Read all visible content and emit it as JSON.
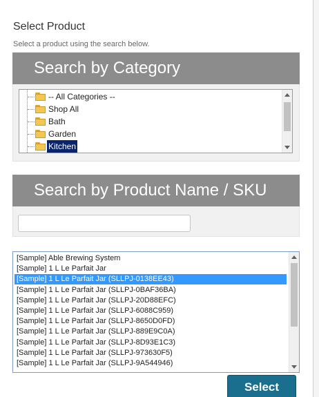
{
  "dialog": {
    "title": "Select Product",
    "subtitle": "Select a product using the search below."
  },
  "category_search": {
    "header": "Search by Category",
    "items": [
      {
        "label": "-- All Categories --",
        "icon": "folder-icon"
      },
      {
        "label": "Shop All",
        "icon": "folder-icon"
      },
      {
        "label": "Bath",
        "icon": "folder-icon"
      },
      {
        "label": "Garden",
        "icon": "folder-icon"
      },
      {
        "label": "Kitchen",
        "icon": "folder-icon",
        "selected": true
      }
    ]
  },
  "name_search": {
    "header": "Search by Product Name / SKU",
    "value": "",
    "placeholder": ""
  },
  "products": {
    "items": [
      "[Sample] Able Brewing System",
      "[Sample] 1 L Le Parfait Jar",
      "[Sample] 1 L Le Parfait Jar (SLLPJ-0138EE43)",
      "[Sample] 1 L Le Parfait Jar (SLLPJ-0BAF36BA)",
      "[Sample] 1 L Le Parfait Jar (SLLPJ-20D88EFC)",
      "[Sample] 1 L Le Parfait Jar (SLLPJ-6088C959)",
      "[Sample] 1 L Le Parfait Jar (SLLPJ-8650D0FD)",
      "[Sample] 1 L Le Parfait Jar (SLLPJ-889E9C0A)",
      "[Sample] 1 L Le Parfait Jar (SLLPJ-8D93E1C3)",
      "[Sample] 1 L Le Parfait Jar (SLLPJ-973630F5)",
      "[Sample] 1 L Le Parfait Jar (SLLPJ-9A544946)"
    ],
    "selected_index": 2
  },
  "actions": {
    "select_label": "Select"
  },
  "colors": {
    "header_bg": "#8c8c8c",
    "tree_selected": "#0a246a",
    "list_selected": "#3399ff",
    "button_bg": "#1a6f8f"
  }
}
